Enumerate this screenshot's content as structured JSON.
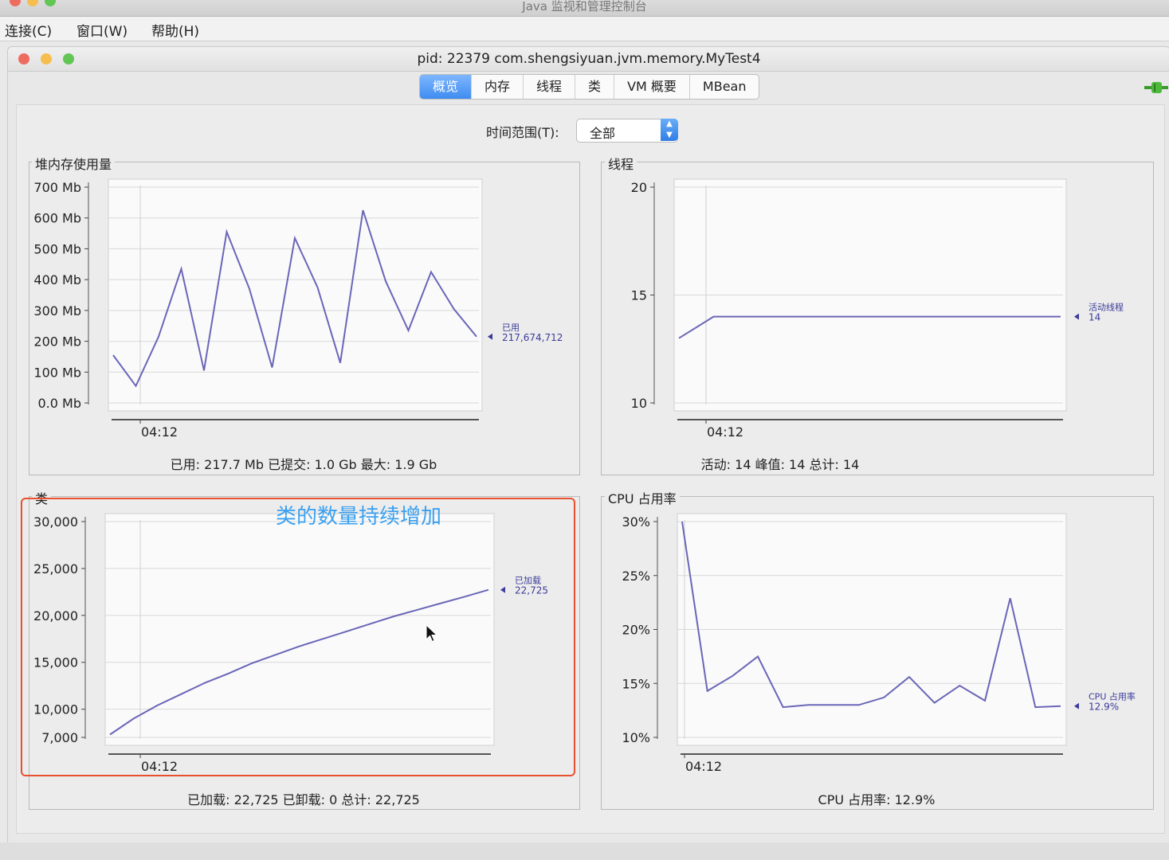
{
  "window": {
    "outer_title": "Java 监视和管理控制台",
    "inner_title": "pid: 22379 com.shengsiyuan.jvm.memory.MyTest4"
  },
  "menu": [
    "连接(C)",
    "窗口(W)",
    "帮助(H)"
  ],
  "tabs": [
    "概览",
    "内存",
    "线程",
    "类",
    "VM 概要",
    "MBean"
  ],
  "active_tab": "概览",
  "time_range": {
    "label": "时间范围(T):",
    "value": "全部"
  },
  "annotation": "类的数量持续增加",
  "colors": {
    "series": "#6a66b8",
    "accent": "#3f8cf0",
    "annotation_box": "#e8502f",
    "annotation_text": "#3aa0f0"
  },
  "icons": [
    "connection-plug-icon",
    "dropdown-arrow-icon",
    "mouse-cursor-icon"
  ],
  "panels": {
    "heap": {
      "title": "堆内存使用量",
      "summary": "已用: 217.7 Mb    已提交: 1.0 Gb    最大: 1.9 Gb"
    },
    "threads": {
      "title": "线程",
      "summary": "活动: 14    峰值: 14    总计: 14"
    },
    "classes": {
      "title": "类",
      "summary": "已加载: 22,725    已卸载: 0    总计: 22,725"
    },
    "cpu": {
      "title": "CPU 占用率",
      "summary": "CPU 占用率: 12.9%"
    }
  },
  "chart_data": [
    {
      "type": "line",
      "title": "堆内存使用量",
      "x_tick_labels": [
        "04:12"
      ],
      "y_tick_labels": [
        "0.0 Mb",
        "100 Mb",
        "200 Mb",
        "300 Mb",
        "400 Mb",
        "500 Mb",
        "600 Mb",
        "700 Mb"
      ],
      "ylim": [
        0,
        700
      ],
      "grid": true,
      "series": [
        {
          "name": "已用",
          "current_value": "217,674,712",
          "values": [
            155,
            55,
            215,
            435,
            105,
            555,
            370,
            115,
            535,
            375,
            130,
            625,
            395,
            235,
            425,
            305,
            215
          ]
        }
      ]
    },
    {
      "type": "line",
      "title": "线程",
      "x_tick_labels": [
        "04:12"
      ],
      "y_tick_labels": [
        "10",
        "15",
        "20"
      ],
      "ylim": [
        10,
        20
      ],
      "grid": true,
      "series": [
        {
          "name": "活动线程",
          "current_value": "14",
          "values": [
            13,
            14,
            14,
            14,
            14,
            14,
            14,
            14,
            14,
            14,
            14,
            14
          ]
        }
      ]
    },
    {
      "type": "line",
      "title": "类",
      "x_tick_labels": [
        "04:12"
      ],
      "y_tick_labels": [
        "7,000",
        "10,000",
        "15,000",
        "20,000",
        "25,000",
        "30,000"
      ],
      "ylim": [
        7000,
        30000
      ],
      "grid": true,
      "series": [
        {
          "name": "已加载",
          "current_value": "22,725",
          "values": [
            7300,
            9000,
            10400,
            11600,
            12800,
            13800,
            14900,
            15800,
            16700,
            17500,
            18300,
            19100,
            19900,
            20600,
            21300,
            22000,
            22725
          ]
        }
      ]
    },
    {
      "type": "line",
      "title": "CPU 占用率",
      "x_tick_labels": [
        "04:12"
      ],
      "y_tick_labels": [
        "10%",
        "15%",
        "20%",
        "25%",
        "30%"
      ],
      "ylim": [
        10,
        30
      ],
      "grid": true,
      "series": [
        {
          "name": "CPU 占用率",
          "current_value": "12.9%",
          "values": [
            30,
            14.3,
            15.7,
            17.5,
            12.8,
            13,
            13,
            13,
            13.7,
            15.6,
            13.2,
            14.8,
            13.4,
            22.9,
            12.8,
            12.9
          ]
        }
      ]
    }
  ]
}
